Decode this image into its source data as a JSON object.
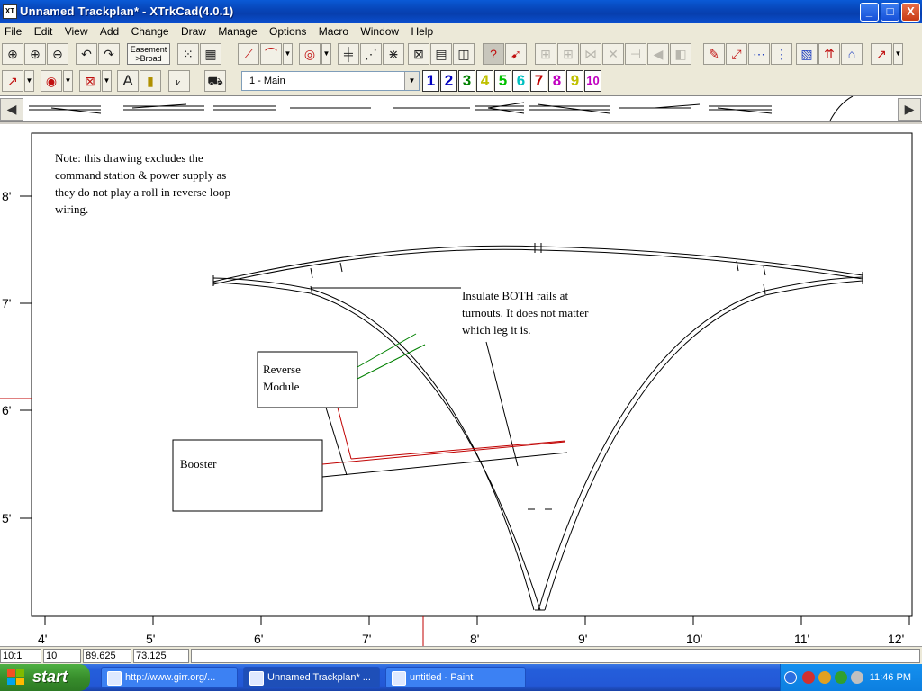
{
  "window": {
    "title": "Unnamed Trackplan* - XTrkCad(4.0.1)",
    "app_icon_text": "XT",
    "minimize": "_",
    "maximize": "□",
    "close": "X"
  },
  "menu": [
    "File",
    "Edit",
    "View",
    "Add",
    "Change",
    "Draw",
    "Manage",
    "Options",
    "Macro",
    "Window",
    "Help"
  ],
  "toolbar": {
    "easement_line1": "Easement",
    "easement_line2": ">Broad",
    "layer_selected": "1 - Main",
    "layers": [
      "1",
      "2",
      "3",
      "4",
      "5",
      "6",
      "7",
      "8",
      "9",
      "10"
    ],
    "layer_colors": [
      "#0000c0",
      "#0000c0",
      "#008000",
      "#c0c000",
      "#00c000",
      "#00c0c0",
      "#c00000",
      "#c000c0",
      "#c0c000",
      "#c000c0"
    ],
    "text_tool": "A"
  },
  "canvas": {
    "y_ticks": [
      "8'",
      "7'",
      "6'",
      "5'"
    ],
    "x_ticks": [
      "4'",
      "5'",
      "6'",
      "7'",
      "8'",
      "9'",
      "10'",
      "11'",
      "12'"
    ],
    "note_lines": [
      "Note: this drawing excludes the",
      "command station & power supply as",
      "they do not play a roll in reverse loop",
      "wiring."
    ],
    "insulate_lines": [
      "Insulate BOTH rails at",
      "turnouts. It does not matter",
      "which leg it is."
    ],
    "reverse_module_lines": [
      "Reverse",
      "Module"
    ],
    "booster_label": "Booster",
    "colors": {
      "track": "#000000",
      "red_wire": "#c00000",
      "green_wire": "#008000"
    }
  },
  "status": {
    "scale": "10:1",
    "field2": "10",
    "x": "89.625",
    "y": "73.125"
  },
  "taskbar": {
    "start": "start",
    "items": [
      "http://www.girr.org/...",
      "Unnamed Trackplan* ...",
      "untitled - Paint"
    ],
    "clock": "11:46 PM"
  }
}
